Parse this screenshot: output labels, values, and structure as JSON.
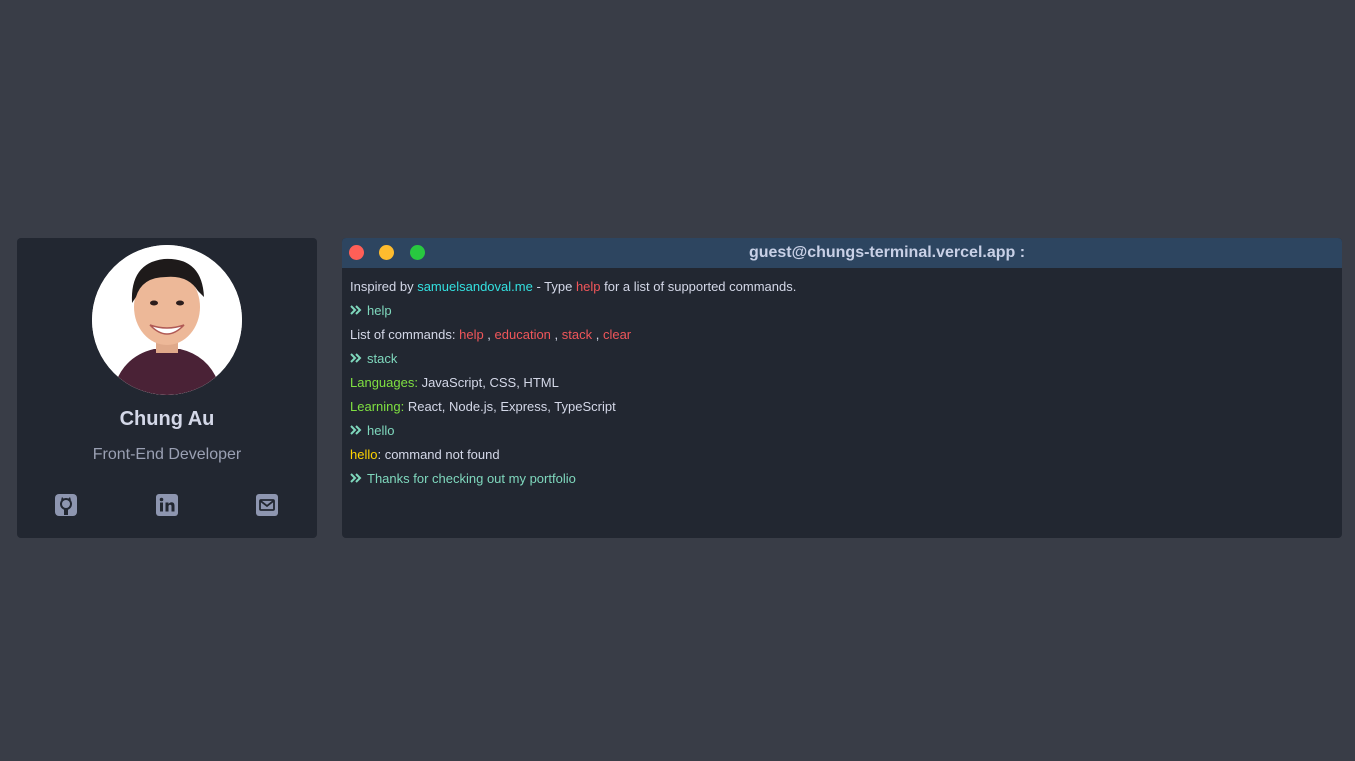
{
  "profile": {
    "name": "Chung Au",
    "role": "Front-End Developer",
    "social_icons": [
      "github-icon",
      "linkedin-icon",
      "email-icon"
    ]
  },
  "terminal": {
    "title": "guest@chungs-terminal.vercel.app :",
    "intro": {
      "prefix": "Inspired by ",
      "link": "samuelsandoval.me",
      "middle": " - Type ",
      "cmd": "help",
      "suffix": " for a list of supported commands."
    },
    "cmd1": "help",
    "commands_label": "List of commands: ",
    "commands": [
      "help",
      "education",
      "stack",
      "clear"
    ],
    "separator": " , ",
    "cmd2": "stack",
    "languages_label": "Languages:",
    "languages_value": " JavaScript, CSS, HTML",
    "learning_label": "Learning:",
    "learning_value": " React, Node.js, Express, TypeScript",
    "cmd3": "hello",
    "error_cmd": "hello",
    "error_msg": ": command not found",
    "final_prompt": "Thanks for checking out my portfolio"
  },
  "colors": {
    "background": "#393d47",
    "panel": "#222731",
    "title_bar": "#2d4560",
    "link": "#33e0e0",
    "command": "#f0565a",
    "label": "#7fe041",
    "error": "#ffd400",
    "prompt": "#7fd8bd"
  }
}
